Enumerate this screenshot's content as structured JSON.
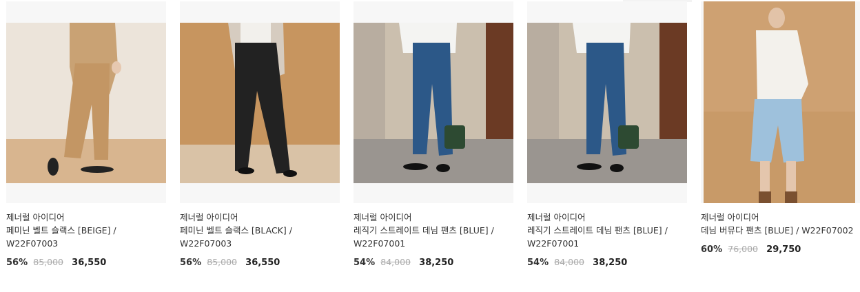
{
  "products": [
    {
      "brand": "제너럴 아이디어",
      "name": "페미닌 벨트 슬랙스 [BEIGE] / W22F07003",
      "discount": "56%",
      "original_price": "85,000",
      "sale_price": "36,550"
    },
    {
      "brand": "제너럴 아이디어",
      "name": "페미닌 벨트 슬랙스 [BLACK] / W22F07003",
      "discount": "56%",
      "original_price": "85,000",
      "sale_price": "36,550"
    },
    {
      "brand": "제너럴 아이디어",
      "name": "레직기 스트레이트 데님 팬츠 [BLUE] / W22F07001",
      "discount": "54%",
      "original_price": "84,000",
      "sale_price": "38,250"
    },
    {
      "brand": "제너럴 아이디어",
      "name": "레직기 스트레이트 데님 팬츠 [BLUE] / W22F07001",
      "discount": "54%",
      "original_price": "84,000",
      "sale_price": "38,250"
    },
    {
      "brand": "제너럴 아이디어",
      "name": "데님 버뮤다 팬츠 [BLUE] / W22F07002",
      "discount": "60%",
      "original_price": "76,000",
      "sale_price": "29,750"
    }
  ]
}
